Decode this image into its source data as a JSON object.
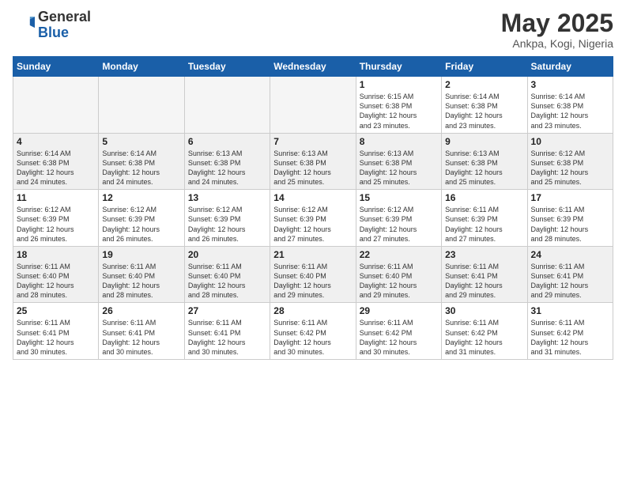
{
  "header": {
    "logo_general": "General",
    "logo_blue": "Blue",
    "month_year": "May 2025",
    "location": "Ankpa, Kogi, Nigeria"
  },
  "weekdays": [
    "Sunday",
    "Monday",
    "Tuesday",
    "Wednesday",
    "Thursday",
    "Friday",
    "Saturday"
  ],
  "weeks": [
    [
      {
        "day": "",
        "info": ""
      },
      {
        "day": "",
        "info": ""
      },
      {
        "day": "",
        "info": ""
      },
      {
        "day": "",
        "info": ""
      },
      {
        "day": "1",
        "info": "Sunrise: 6:15 AM\nSunset: 6:38 PM\nDaylight: 12 hours\nand 23 minutes."
      },
      {
        "day": "2",
        "info": "Sunrise: 6:14 AM\nSunset: 6:38 PM\nDaylight: 12 hours\nand 23 minutes."
      },
      {
        "day": "3",
        "info": "Sunrise: 6:14 AM\nSunset: 6:38 PM\nDaylight: 12 hours\nand 23 minutes."
      }
    ],
    [
      {
        "day": "4",
        "info": "Sunrise: 6:14 AM\nSunset: 6:38 PM\nDaylight: 12 hours\nand 24 minutes."
      },
      {
        "day": "5",
        "info": "Sunrise: 6:14 AM\nSunset: 6:38 PM\nDaylight: 12 hours\nand 24 minutes."
      },
      {
        "day": "6",
        "info": "Sunrise: 6:13 AM\nSunset: 6:38 PM\nDaylight: 12 hours\nand 24 minutes."
      },
      {
        "day": "7",
        "info": "Sunrise: 6:13 AM\nSunset: 6:38 PM\nDaylight: 12 hours\nand 25 minutes."
      },
      {
        "day": "8",
        "info": "Sunrise: 6:13 AM\nSunset: 6:38 PM\nDaylight: 12 hours\nand 25 minutes."
      },
      {
        "day": "9",
        "info": "Sunrise: 6:13 AM\nSunset: 6:38 PM\nDaylight: 12 hours\nand 25 minutes."
      },
      {
        "day": "10",
        "info": "Sunrise: 6:12 AM\nSunset: 6:38 PM\nDaylight: 12 hours\nand 25 minutes."
      }
    ],
    [
      {
        "day": "11",
        "info": "Sunrise: 6:12 AM\nSunset: 6:39 PM\nDaylight: 12 hours\nand 26 minutes."
      },
      {
        "day": "12",
        "info": "Sunrise: 6:12 AM\nSunset: 6:39 PM\nDaylight: 12 hours\nand 26 minutes."
      },
      {
        "day": "13",
        "info": "Sunrise: 6:12 AM\nSunset: 6:39 PM\nDaylight: 12 hours\nand 26 minutes."
      },
      {
        "day": "14",
        "info": "Sunrise: 6:12 AM\nSunset: 6:39 PM\nDaylight: 12 hours\nand 27 minutes."
      },
      {
        "day": "15",
        "info": "Sunrise: 6:12 AM\nSunset: 6:39 PM\nDaylight: 12 hours\nand 27 minutes."
      },
      {
        "day": "16",
        "info": "Sunrise: 6:11 AM\nSunset: 6:39 PM\nDaylight: 12 hours\nand 27 minutes."
      },
      {
        "day": "17",
        "info": "Sunrise: 6:11 AM\nSunset: 6:39 PM\nDaylight: 12 hours\nand 28 minutes."
      }
    ],
    [
      {
        "day": "18",
        "info": "Sunrise: 6:11 AM\nSunset: 6:40 PM\nDaylight: 12 hours\nand 28 minutes."
      },
      {
        "day": "19",
        "info": "Sunrise: 6:11 AM\nSunset: 6:40 PM\nDaylight: 12 hours\nand 28 minutes."
      },
      {
        "day": "20",
        "info": "Sunrise: 6:11 AM\nSunset: 6:40 PM\nDaylight: 12 hours\nand 28 minutes."
      },
      {
        "day": "21",
        "info": "Sunrise: 6:11 AM\nSunset: 6:40 PM\nDaylight: 12 hours\nand 29 minutes."
      },
      {
        "day": "22",
        "info": "Sunrise: 6:11 AM\nSunset: 6:40 PM\nDaylight: 12 hours\nand 29 minutes."
      },
      {
        "day": "23",
        "info": "Sunrise: 6:11 AM\nSunset: 6:41 PM\nDaylight: 12 hours\nand 29 minutes."
      },
      {
        "day": "24",
        "info": "Sunrise: 6:11 AM\nSunset: 6:41 PM\nDaylight: 12 hours\nand 29 minutes."
      }
    ],
    [
      {
        "day": "25",
        "info": "Sunrise: 6:11 AM\nSunset: 6:41 PM\nDaylight: 12 hours\nand 30 minutes."
      },
      {
        "day": "26",
        "info": "Sunrise: 6:11 AM\nSunset: 6:41 PM\nDaylight: 12 hours\nand 30 minutes."
      },
      {
        "day": "27",
        "info": "Sunrise: 6:11 AM\nSunset: 6:41 PM\nDaylight: 12 hours\nand 30 minutes."
      },
      {
        "day": "28",
        "info": "Sunrise: 6:11 AM\nSunset: 6:42 PM\nDaylight: 12 hours\nand 30 minutes."
      },
      {
        "day": "29",
        "info": "Sunrise: 6:11 AM\nSunset: 6:42 PM\nDaylight: 12 hours\nand 30 minutes."
      },
      {
        "day": "30",
        "info": "Sunrise: 6:11 AM\nSunset: 6:42 PM\nDaylight: 12 hours\nand 31 minutes."
      },
      {
        "day": "31",
        "info": "Sunrise: 6:11 AM\nSunset: 6:42 PM\nDaylight: 12 hours\nand 31 minutes."
      }
    ]
  ]
}
